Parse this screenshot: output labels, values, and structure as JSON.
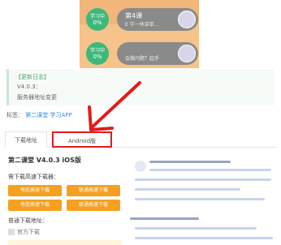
{
  "phone": {
    "lessons": [
      {
        "circle_top": "学习中",
        "circle_pct": "0%",
        "title": "第4课",
        "subtitle": "E 字一休讲单..."
      },
      {
        "circle_top": "学习中",
        "circle_pct": "0%",
        "title": "",
        "subtitle": "会做问题？起手"
      }
    ]
  },
  "update_log": {
    "heading": "【更新日志】",
    "version": "V4.0.3：",
    "detail": "服务器地址变更"
  },
  "tags": {
    "label": "标签：",
    "links": [
      "第二课堂",
      "学习APP"
    ]
  },
  "tabs": [
    {
      "label": "下载地址"
    },
    {
      "label": "Android版"
    }
  ],
  "version_title": "第二课堂 V4.0.3 iOS版",
  "fast_download": {
    "heading": "需下载高速下载器：",
    "buttons": [
      [
        "电信高速下载",
        "联通高速下载"
      ],
      [
        "电信高速下载",
        "联通高速下载"
      ]
    ]
  },
  "normal_download": {
    "heading": "普通下载地址：",
    "official": "官方下载"
  },
  "colors": {
    "accent_red": "#e21b1b",
    "download_orange": "#f5a020",
    "learning_green": "#3cb97a"
  }
}
